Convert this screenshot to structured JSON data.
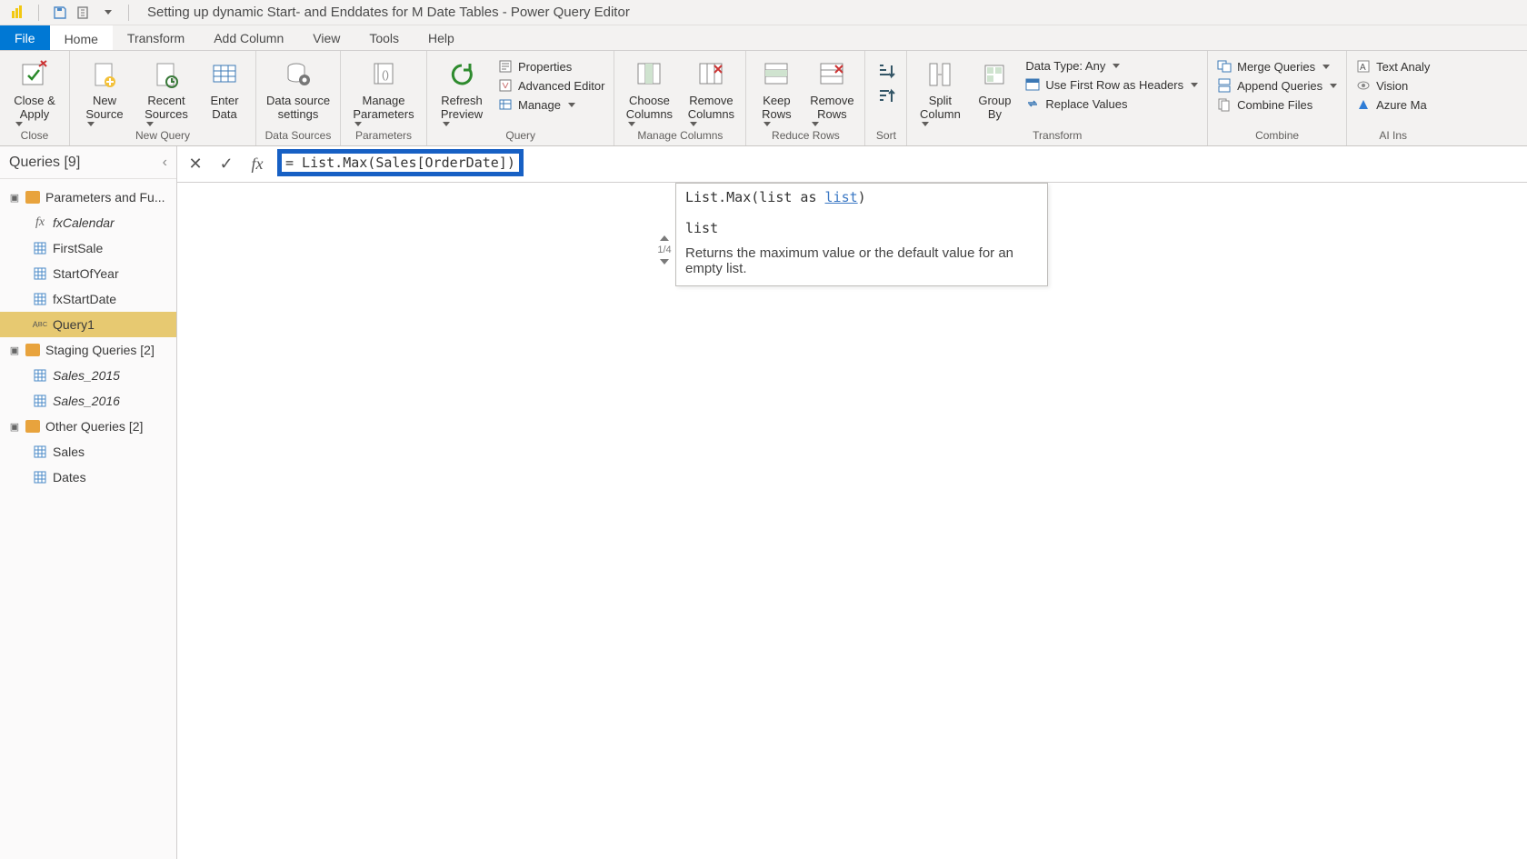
{
  "titlebar": {
    "title": "Setting up dynamic Start- and Enddates for M Date Tables - Power Query Editor"
  },
  "menutabs": {
    "file": "File",
    "home": "Home",
    "transform": "Transform",
    "addcolumn": "Add Column",
    "view": "View",
    "tools": "Tools",
    "help": "Help"
  },
  "ribbon": {
    "close": {
      "close_apply": "Close &",
      "close_apply2": "Apply",
      "group": "Close"
    },
    "newquery": {
      "new_source": "New",
      "new_source2": "Source",
      "recent_sources": "Recent",
      "recent_sources2": "Sources",
      "enter_data": "Enter",
      "enter_data2": "Data",
      "group": "New Query"
    },
    "datasources": {
      "data_source_settings": "Data source",
      "data_source_settings2": "settings",
      "group": "Data Sources"
    },
    "parameters": {
      "manage_parameters": "Manage",
      "manage_parameters2": "Parameters",
      "group": "Parameters"
    },
    "query": {
      "refresh_preview": "Refresh",
      "refresh_preview2": "Preview",
      "properties": "Properties",
      "advanced_editor": "Advanced Editor",
      "manage": "Manage",
      "group": "Query"
    },
    "managecols": {
      "choose_columns": "Choose",
      "choose_columns2": "Columns",
      "remove_columns": "Remove",
      "remove_columns2": "Columns",
      "group": "Manage Columns"
    },
    "reducerows": {
      "keep_rows": "Keep",
      "keep_rows2": "Rows",
      "remove_rows": "Remove",
      "remove_rows2": "Rows",
      "group": "Reduce Rows"
    },
    "sort": {
      "group": "Sort"
    },
    "transform": {
      "split_column": "Split",
      "split_column2": "Column",
      "group_by": "Group",
      "group_by2": "By",
      "data_type": "Data Type: Any",
      "first_row_headers": "Use First Row as Headers",
      "replace_values": "Replace Values",
      "group": "Transform"
    },
    "combine": {
      "merge_queries": "Merge Queries",
      "append_queries": "Append Queries",
      "combine_files": "Combine Files",
      "group": "Combine"
    },
    "ai": {
      "text_analytics": "Text Analy",
      "vision": "Vision",
      "azure_ml": "Azure Ma",
      "group": "AI Ins"
    }
  },
  "queries": {
    "header": "Queries [9]",
    "groups": {
      "paramfunc": "Parameters and Fu...",
      "staging": "Staging Queries [2]",
      "other": "Other Queries [2]"
    },
    "items": {
      "fxcalendar": "fxCalendar",
      "firstsale": "FirstSale",
      "startofyear": "StartOfYear",
      "fxstartdate": "fxStartDate",
      "query1": "Query1",
      "sales2015": "Sales_2015",
      "sales2016": "Sales_2016",
      "sales": "Sales",
      "dates": "Dates"
    }
  },
  "formula": {
    "text": "= List.Max(Sales[OrderDate])"
  },
  "tooltip": {
    "sig_prefix": "List.Max(list as ",
    "sig_kw": "list",
    "sig_suffix": ")",
    "param": "list",
    "desc": "Returns the maximum value or the default value for an empty list.",
    "counter": "1/4"
  }
}
